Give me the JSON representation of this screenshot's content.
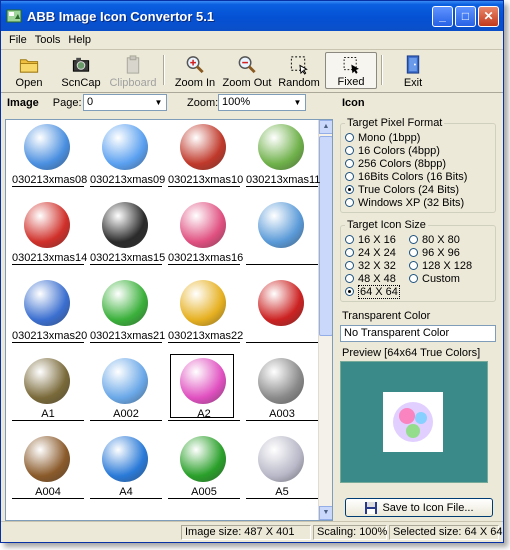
{
  "window": {
    "title": "ABB Image Icon Convertor 5.1",
    "buttons": [
      "_",
      "□",
      "✕"
    ]
  },
  "menu": [
    "File",
    "Tools",
    "Help"
  ],
  "toolbar": [
    {
      "label": "Open",
      "icon": "folder-icon"
    },
    {
      "label": "ScnCap",
      "icon": "camera-icon"
    },
    {
      "label": "Clipboard",
      "icon": "clipboard-icon",
      "disabled": true
    },
    {
      "label": "Zoom In",
      "icon": "zoom-in-icon"
    },
    {
      "label": "Zoom Out",
      "icon": "zoom-out-icon"
    },
    {
      "label": "Random",
      "icon": "random-select-icon"
    },
    {
      "label": "Fixed",
      "icon": "fixed-select-icon",
      "pressed": true
    },
    {
      "label": "Exit",
      "icon": "exit-door-icon"
    }
  ],
  "image_panel": {
    "heading": "Image",
    "page_label": "Page:",
    "page_value": "0",
    "zoom_label": "Zoom:",
    "zoom_value": "100%"
  },
  "gallery": [
    {
      "caption": "030213xmas08",
      "icon": "finder-icon",
      "color": "#4a8fe0"
    },
    {
      "caption": "030213xmas09",
      "icon": "folder-icon",
      "color": "#5aa0f0"
    },
    {
      "caption": "030213xmas10",
      "icon": "home-icon",
      "color": "#c0392b"
    },
    {
      "caption": "030213xmas11",
      "icon": "book-icon",
      "color": "#6fb14a"
    },
    {
      "caption": "030213xmas14",
      "icon": "mailbox-icon",
      "color": "#d0302a"
    },
    {
      "caption": "030213xmas15",
      "icon": "clapperboard-icon",
      "color": "#2b2b2b"
    },
    {
      "caption": "030213xmas16",
      "icon": "bubbles-icon",
      "color": "#e05080"
    },
    {
      "caption": "",
      "icon": "image-icon",
      "color": "#5a9ad8"
    },
    {
      "caption": "030213xmas20",
      "icon": "xmas-x-icon",
      "color": "#3b6fd0"
    },
    {
      "caption": "030213xmas21",
      "icon": "green-bubbles-icon",
      "color": "#3ab03a"
    },
    {
      "caption": "030213xmas22",
      "icon": "bell-icon",
      "color": "#e6b020"
    },
    {
      "caption": "",
      "icon": "santa-icon",
      "color": "#cc2222"
    },
    {
      "caption": "A1",
      "icon": "globe-disc-icon",
      "color": "#7a6a3a"
    },
    {
      "caption": "A002",
      "icon": "igloo-penguin-icon",
      "color": "#6aa8e8"
    },
    {
      "caption": "A2",
      "icon": "bubbles-icon",
      "color": "#e050c0"
    },
    {
      "caption": "A003",
      "icon": "phone-penguin-icon",
      "color": "#8a8a8a"
    },
    {
      "caption": "A004",
      "icon": "house-icon",
      "color": "#8a5a2a"
    },
    {
      "caption": "A4",
      "icon": "earth-icon",
      "color": "#2a7ad8"
    },
    {
      "caption": "A005",
      "icon": "green-house-icon",
      "color": "#2aa02a"
    },
    {
      "caption": "A5",
      "icon": "dome-icon",
      "color": "#b8b8c8"
    }
  ],
  "icon_panel": {
    "heading": "Icon",
    "pixel_format_legend": "Target Pixel Format",
    "pixel_formats": [
      "Mono (1bpp)",
      "16 Colors (4bpp)",
      "256 Colors (8bpp)",
      "16Bits Colors (16 Bits)",
      "True Colors (24 Bits)",
      "Windows XP (32 Bits)"
    ],
    "pixel_format_selected": "True Colors (24 Bits)",
    "size_legend": "Target Icon Size",
    "sizes": [
      "16 X 16",
      "80 X 80",
      "24 X 24",
      "96 X 96",
      "32 X 32",
      "128 X 128",
      "48 X 48",
      "Custom",
      "64 X 64"
    ],
    "size_selected": "64 X 64",
    "transparent_label": "Transparent Color",
    "transparent_value": "No Transparent Color",
    "preview_label": "Preview [64x64 True Colors]",
    "save_label": "Save to Icon File..."
  },
  "status": {
    "image_size": "Image size: 487 X 401",
    "scaling": "Scaling: 100%",
    "selected": "Selected size: 64 X 64"
  }
}
